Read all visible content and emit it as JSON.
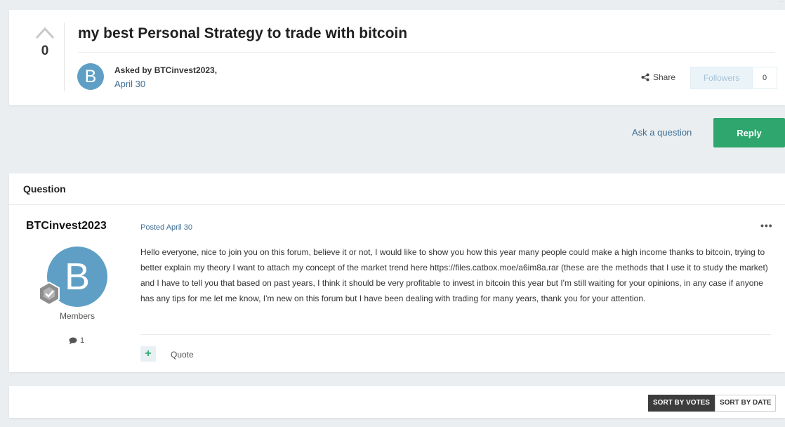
{
  "header": {
    "vote_count": "0",
    "title": "my best Personal Strategy to trade with bitcoin",
    "avatar_letter": "B",
    "asked_by": "Asked by BTCinvest2023,",
    "asked_date": "April 30",
    "share_label": "Share",
    "followers_label": "Followers",
    "followers_count": "0"
  },
  "actions": {
    "ask_label": "Ask a question",
    "reply_label": "Reply"
  },
  "question": {
    "section_title": "Question",
    "author": "BTCinvest2023",
    "avatar_letter": "B",
    "group": "Members",
    "post_count": "1",
    "posted": "Posted April 30",
    "more": "•••",
    "body": "Hello everyone, nice to join you on this forum, believe it or not, I would like to show you how this year many people could make a high income thanks to bitcoin, trying to better explain my theory I want to attach my concept of the market trend here https://files.catbox.moe/a6im8a.rar (these are the methods that I use it to study the market) and I have to tell you that based on past years, I think it should be very profitable to invest in bitcoin this year but I'm still waiting for your opinions, in any case if anyone has any tips for me let me know, I'm new on this forum but I have been dealing with trading for many years, thank you for your attention.",
    "plus": "+",
    "quote_label": "Quote"
  },
  "sort": {
    "by_votes": "SORT BY VOTES",
    "by_date": "SORT BY DATE"
  },
  "colors": {
    "accent": "#2ea66d",
    "link": "#3d6e94",
    "avatar": "#5f9fc6",
    "background": "#ebeef0"
  }
}
